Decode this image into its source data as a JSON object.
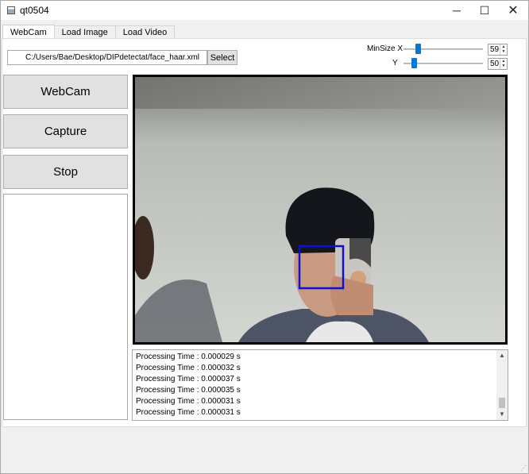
{
  "window": {
    "title": "qt0504",
    "minimize_glyph": "─",
    "maximize_glyph": "☐",
    "close_glyph": "✕"
  },
  "tabs": [
    {
      "label": "WebCam",
      "active": true
    },
    {
      "label": "Load Image",
      "active": false
    },
    {
      "label": "Load Video",
      "active": false
    }
  ],
  "cascade": {
    "path": "C:/Users/Bae/Desktop/DIPdetectat/face_haar.xml",
    "select_label": "Select"
  },
  "minsize": {
    "x_label": "MinSize X",
    "y_label": "Y",
    "x_value": "59",
    "y_value": "50"
  },
  "buttons": {
    "webcam": "WebCam",
    "capture": "Capture",
    "stop": "Stop"
  },
  "log": [
    "Processing Time : 0.000029 s",
    "Processing Time : 0.000032 s",
    "Processing Time : 0.000037 s",
    "Processing Time : 0.000035 s",
    "Processing Time : 0.000031 s",
    "Processing Time : 0.000031 s"
  ],
  "colors": {
    "accent": "#0078d7",
    "detection_box": "#1010d0"
  }
}
